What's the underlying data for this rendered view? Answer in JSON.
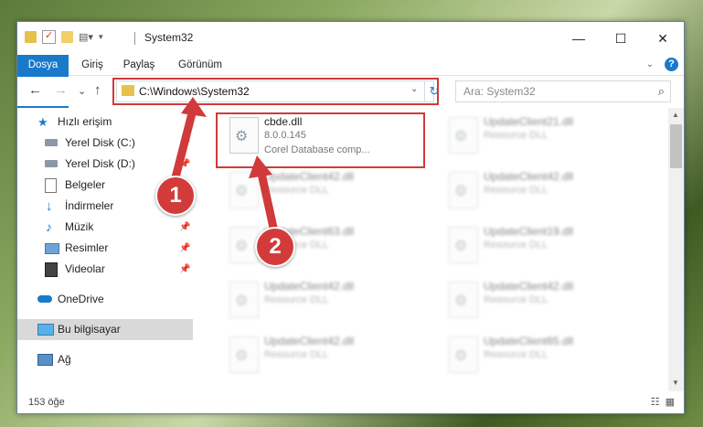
{
  "window": {
    "title": "System32"
  },
  "window_controls": {
    "minimize": "—",
    "maximize": "☐",
    "close": "✕"
  },
  "ribbon": {
    "tabs": [
      "Dosya",
      "Giriş",
      "Paylaş",
      "Görünüm"
    ]
  },
  "nav": {
    "back": "←",
    "forward": "→",
    "recent": "⌄",
    "up": "↑",
    "address": "C:\\Windows\\System32",
    "refresh": "↻",
    "search_placeholder": "Ara: System32"
  },
  "sidebar": {
    "items": [
      {
        "label": "Hızlı erişim",
        "icon": "star-icon"
      },
      {
        "label": "Yerel Disk (C:)",
        "icon": "drive-icon",
        "pinned": true
      },
      {
        "label": "Yerel Disk (D:)",
        "icon": "drive-icon",
        "pinned": true
      },
      {
        "label": "Belgeler",
        "icon": "documents-icon",
        "pinned": true
      },
      {
        "label": "İndirmeler",
        "icon": "download-icon",
        "pinned": true
      },
      {
        "label": "Müzik",
        "icon": "music-icon",
        "pinned": true
      },
      {
        "label": "Resimler",
        "icon": "pictures-icon",
        "pinned": true
      },
      {
        "label": "Videolar",
        "icon": "videos-icon",
        "pinned": true
      },
      {
        "label": "OneDrive",
        "icon": "cloud-icon"
      },
      {
        "label": "Bu bilgisayar",
        "icon": "computer-icon",
        "selected": true
      },
      {
        "label": "Ağ",
        "icon": "network-icon"
      }
    ]
  },
  "files": {
    "highlighted": {
      "name": "cbde.dll",
      "version": "8.0.0.145",
      "description": "Corel Database comp..."
    },
    "blurred": [
      {
        "name": "UpdateClient21.dll",
        "sub": "Resource DLL"
      },
      {
        "name": "UpdateClient42.dll",
        "sub": "Resource DLL"
      },
      {
        "name": "UpdateClient42.dll",
        "sub": "Resource DLL"
      },
      {
        "name": "UpdateClient63.dll",
        "sub": "Resource DLL"
      },
      {
        "name": "UpdateClient19.dll",
        "sub": "Resource DLL"
      },
      {
        "name": "UpdateClient42.dll",
        "sub": "Resource DLL"
      },
      {
        "name": "UpdateClient42.dll",
        "sub": "Resource DLL"
      },
      {
        "name": "UpdateClient42.dll",
        "sub": "Resource DLL"
      },
      {
        "name": "UpdateClient65.dll",
        "sub": "Resource DLL"
      }
    ]
  },
  "status": {
    "count": "153 öğe"
  },
  "annotations": {
    "step1": "1",
    "step2": "2"
  },
  "colors": {
    "accent": "#1979ca",
    "highlight_red": "#d03a3a"
  }
}
